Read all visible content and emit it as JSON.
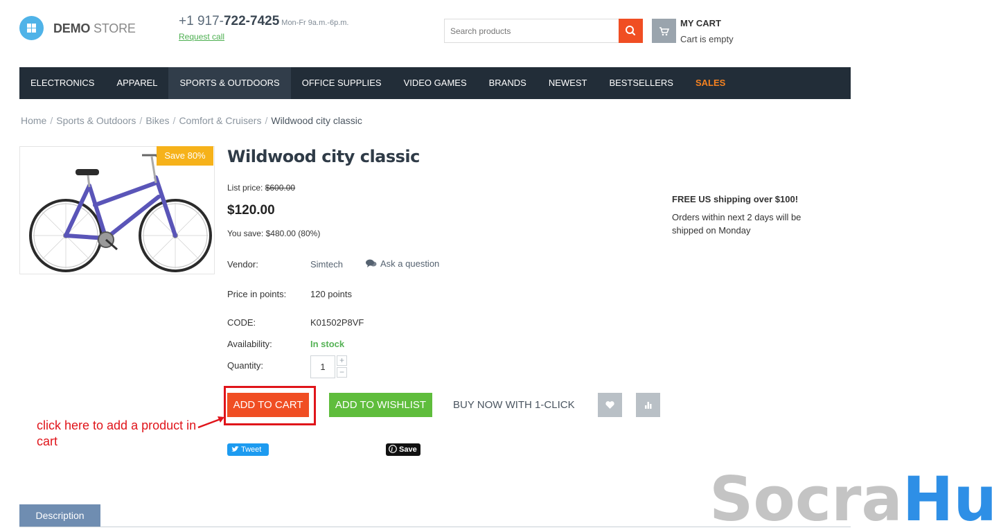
{
  "header": {
    "logo_bold": "DEMO",
    "logo_light": "STORE",
    "phone_prefix": "+1 917-",
    "phone_main": "722-7425",
    "phone_hours": "Mon-Fr 9a.m.-6p.m.",
    "request_call": "Request call",
    "search_placeholder": "Search products",
    "cart_title": "MY CART",
    "cart_status": "Cart is empty"
  },
  "nav": {
    "items": [
      {
        "label": "ELECTRONICS"
      },
      {
        "label": "APPAREL"
      },
      {
        "label": "SPORTS & OUTDOORS"
      },
      {
        "label": "OFFICE SUPPLIES"
      },
      {
        "label": "VIDEO GAMES"
      },
      {
        "label": "BRANDS"
      },
      {
        "label": "NEWEST"
      },
      {
        "label": "BESTSELLERS"
      },
      {
        "label": "SALES"
      }
    ]
  },
  "breadcrumb": {
    "items": [
      "Home",
      "Sports & Outdoors",
      "Bikes",
      "Comfort & Cruisers"
    ],
    "current": "Wildwood city classic",
    "separator": "/"
  },
  "product": {
    "save_badge": "Save 80%",
    "title": "Wildwood city classic",
    "list_price_label": "List price:",
    "list_price": "$600.00",
    "price": "$120.00",
    "you_save": "You save: $480.00 (80%)",
    "vendor_label": "Vendor:",
    "vendor": "Simtech",
    "ask_question": "Ask a question",
    "points_label": "Price in points:",
    "points": "120 points",
    "code_label": "CODE:",
    "code": "K01502P8VF",
    "availability_label": "Availability:",
    "availability": "In stock",
    "quantity_label": "Quantity:",
    "quantity": "1",
    "qty_plus": "+",
    "qty_minus": "−"
  },
  "actions": {
    "add_to_cart": "ADD TO CART",
    "add_to_wishlist": "ADD TO WISHLIST",
    "buy_now": "BUY NOW WITH 1-CLICK"
  },
  "annotation": {
    "text": "click here to add a product in cart"
  },
  "social": {
    "tweet": "Tweet",
    "pin_save": "Save"
  },
  "shipping": {
    "title": "FREE US shipping over $100!",
    "text": "Orders within next 2 days will be shipped on Monday"
  },
  "tabs": {
    "description": "Description"
  },
  "watermark": {
    "part1": "Socra",
    "part2": "Hub"
  },
  "colors": {
    "accent": "#f04e23",
    "nav_bg": "#222d38",
    "success": "#5fbd3c",
    "sales": "#f58220",
    "annotation": "#e0141a"
  }
}
